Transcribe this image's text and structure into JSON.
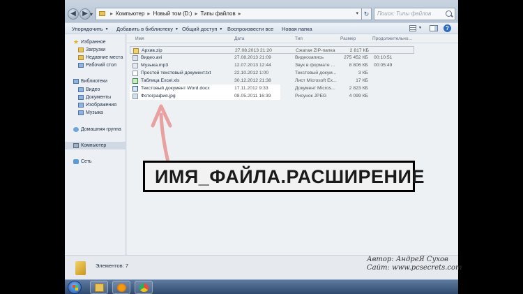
{
  "address_bar": {
    "path": [
      "Компьютер",
      "Новый том (D:)",
      "Типы файлов"
    ],
    "search_placeholder": "Поиск: Типы файлов"
  },
  "toolbar": {
    "organize": "Упорядочить",
    "add_to_library": "Добавить в библиотеку",
    "share": "Общий доступ",
    "play_all": "Воспроизвести все",
    "new_folder": "Новая папка"
  },
  "nav": {
    "favorites": "Избранное",
    "downloads": "Загрузки",
    "recent_places": "Недавние места",
    "desktop": "Рабочий стол",
    "libraries": "Библиотеки",
    "video": "Видео",
    "documents": "Документы",
    "pictures": "Изображения",
    "music": "Музыка",
    "homegroup": "Домашняя группа",
    "computer": "Компьютер",
    "network": "Сеть"
  },
  "columns": {
    "name": "Имя",
    "date": "Дата",
    "type": "Тип",
    "size": "Размер",
    "duration": "Продолжительно..."
  },
  "files": [
    {
      "name": "Архив.zip",
      "date": "27.08.2013 21:20",
      "type": "Сжатая ZIP-папка",
      "size": "2 817 КБ",
      "duration": ""
    },
    {
      "name": "Видео.avi",
      "date": "27.08.2013 21:09",
      "type": "Видеозапись",
      "size": "275 452 КБ",
      "duration": "00:10:51"
    },
    {
      "name": "Музыка.mp3",
      "date": "12.07.2013 12:44",
      "type": "Звук в формате ...",
      "size": "8 806 КБ",
      "duration": "00:05:49"
    },
    {
      "name": "Простой текстовый документ.txt",
      "date": "22.10.2012 1:00",
      "type": "Текстовый докум...",
      "size": "3 КБ",
      "duration": ""
    },
    {
      "name": "Таблица Excel.xls",
      "date": "30.12.2012 21:38",
      "type": "Лист Microsoft Ex...",
      "size": "17 КБ",
      "duration": ""
    },
    {
      "name": "Текстовый документ Word.docx",
      "date": "17.11.2012 9:33",
      "type": "Документ Micros...",
      "size": "2 823 КБ",
      "duration": ""
    },
    {
      "name": "Фотография.jpg",
      "date": "08.05.2011 16:39",
      "type": "Рисунок JPEG",
      "size": "4 099 КБ",
      "duration": ""
    }
  ],
  "annotation": "ИМЯ_ФАЙЛА.РАСШИРЕНИЕ",
  "status": {
    "count": "Элементов: 7"
  },
  "credit": {
    "author": "Автор: АндреЯ Сухов",
    "site": "Сайт: www.pcsecrets.com"
  },
  "colors": {
    "annotation_arrow": "#e8a0a0",
    "taskbar": "#3b5a84"
  }
}
